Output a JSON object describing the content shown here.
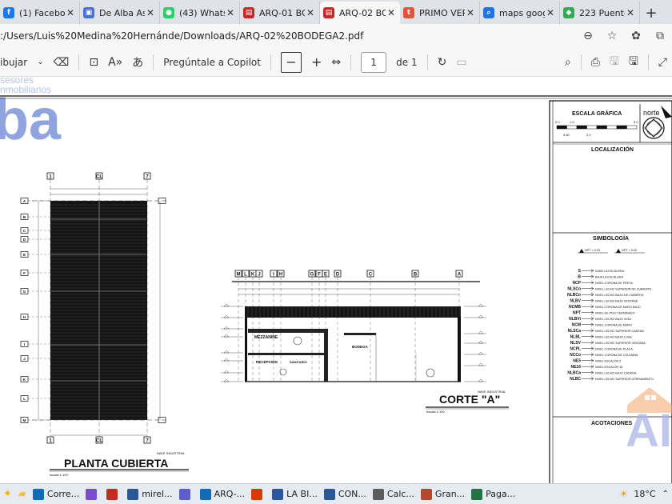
{
  "browser": {
    "tabs": [
      {
        "label": "(1) Facebook",
        "color": "#1877f2",
        "glyph": "f"
      },
      {
        "label": "De Alba Ase",
        "color": "#4a6fd4",
        "glyph": "▣"
      },
      {
        "label": "(43) WhatsA",
        "color": "#25d366",
        "glyph": "●"
      },
      {
        "label": "ARQ-01 BO",
        "color": "#c62828",
        "glyph": "▤"
      },
      {
        "label": "ARQ-02 BO",
        "color": "#c62828",
        "glyph": "▤",
        "active": true
      },
      {
        "label": "PRIMO VER",
        "color": "#e2543a",
        "glyph": "t"
      },
      {
        "label": "maps goog",
        "color": "#1a73e8",
        "glyph": "⌕"
      },
      {
        "label": "223 Puente",
        "color": "#34a853",
        "glyph": "◆"
      }
    ],
    "url": ":/Users/Luis%20Medina%20Hernánde/Downloads/ARQ-02%20BODEGA2.pdf"
  },
  "pdf_toolbar": {
    "draw_label": "ibujar",
    "copilot_label": "Pregúntale a Copilot",
    "page_current": "1",
    "page_total": "de 1"
  },
  "drawing": {
    "logo_small": "sesores\nnmobiliarios",
    "logo_big": "ba",
    "scale_title": "ESCALA GRÁFICA",
    "scale_ticks": [
      "0.0",
      "1.0",
      "5.0",
      "0.50",
      "2.0"
    ],
    "north_label": "norte",
    "location_title": "LOCALIZACIÓN",
    "symbology_title": "SIMBOLOGÍA",
    "npt_labels": [
      "NPT = 0.00",
      "NPT + 0.00"
    ],
    "symbols": [
      {
        "code": "S",
        "desc": "SUBE LA ESCALERA"
      },
      {
        "code": "B",
        "desc": "BAJA LA ESCALERA"
      },
      {
        "code": "NCP",
        "desc": "NIVEL CORONA DE PRETIL"
      },
      {
        "code": "NLSCo",
        "desc": "NIVEL LECHO SUPERIOR DE CUBIERTA"
      },
      {
        "code": "NLBCo",
        "desc": "NIVEL LECHO BAJO DE CUBIERTA"
      },
      {
        "code": "NLBV",
        "desc": "NIVEL LECHO BAJO VENTANA"
      },
      {
        "code": "NCMB",
        "desc": "NIVEL CORONA DE MURO BAJO"
      },
      {
        "code": "NPT",
        "desc": "NIVEL DE PISO TERMINADO"
      },
      {
        "code": "NLBVi",
        "desc": "NIVEL LECHO BAJO VIGA"
      },
      {
        "code": "NCM",
        "desc": "NIVEL CORONA DE MURO"
      },
      {
        "code": "NLSCa",
        "desc": "NIVEL LECHO SUPERIOR CADENA"
      },
      {
        "code": "NLBL",
        "desc": "NIVEL LECHO BAJO LOSA"
      },
      {
        "code": "NLSV",
        "desc": "NIVEL LECHO SUPERIOR VENTANA"
      },
      {
        "code": "NCPL",
        "desc": "NIVEL CORONA DE PLACA"
      },
      {
        "code": "NCCo",
        "desc": "NIVEL CORONA DE COLUMNA"
      },
      {
        "code": "NE5",
        "desc": "NIVEL ESCALÓN 5"
      },
      {
        "code": "NE16",
        "desc": "NIVEL ESCALÓN 16"
      },
      {
        "code": "NLBCa",
        "desc": "NIVEL LECHO BAJO CADENA"
      },
      {
        "code": "NLBC",
        "desc": "NIVEL LECHO SUPERIOR CERRAMIENTO"
      }
    ],
    "annotations_title": "ACOTACIONES",
    "watermark": "AI",
    "plan_title": "PLANTA CUBIERTA",
    "plan_subtitle": "NAVE INDUSTRIAL",
    "plan_scale": "escala 1:100",
    "section_title": "CORTE \"A\"",
    "section_subtitle": "NAVE INDUSTRIAL",
    "section_scale": "escala 1:100",
    "plan_axes_top": [
      "1",
      "CL",
      "7"
    ],
    "plan_axes_left": [
      "A",
      "B",
      "C",
      "D",
      "E",
      "F",
      "G",
      "H",
      "I",
      "J",
      "K",
      "L",
      "M"
    ],
    "section_axes": [
      "M",
      "L",
      "K",
      "J",
      "I",
      "H",
      "G",
      "F",
      "E",
      "D",
      "C",
      "B",
      "A"
    ],
    "rooms": [
      "MEZZANINE",
      "BODEGA",
      "RECEPCIÓN",
      "SANITARIO"
    ]
  },
  "taskbar": {
    "items": [
      {
        "label": "Corre...",
        "color": "#0f6cbd"
      },
      {
        "label": "",
        "color": "#7b4cd6"
      },
      {
        "label": "",
        "color": "#c42b1c"
      },
      {
        "label": "mirel...",
        "color": "#2b5797"
      },
      {
        "label": "",
        "color": "#5b5fc7"
      },
      {
        "label": "ARQ-...",
        "color": "#0f6cbd"
      },
      {
        "label": "",
        "color": "#d83b01"
      },
      {
        "label": "LA BI...",
        "color": "#2b579a"
      },
      {
        "label": "CON...",
        "color": "#2b579a"
      },
      {
        "label": "Calc...",
        "color": "#5c5c5c"
      },
      {
        "label": "Gran...",
        "color": "#b7472a"
      },
      {
        "label": "Paga...",
        "color": "#217346"
      }
    ],
    "temperature": "18°C"
  }
}
